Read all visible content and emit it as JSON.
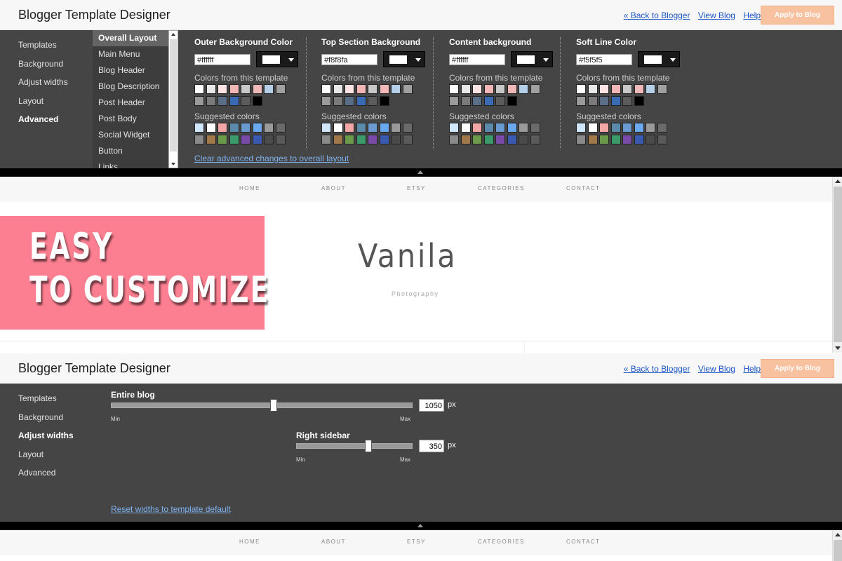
{
  "top": {
    "header": {
      "title": "Blogger Template Designer",
      "back_link": "« Back to Blogger",
      "view_blog": "View Blog",
      "help": "Help",
      "apply": "Apply to Blog"
    },
    "nav": [
      "Templates",
      "Background",
      "Adjust widths",
      "Layout",
      "Advanced"
    ],
    "nav_active": "Advanced",
    "subnav": [
      "Overall Layout",
      "Main Menu",
      "Blog Header",
      "Blog Description",
      "Post Header",
      "Post Body",
      "Social Widget",
      "Button",
      "Links"
    ],
    "subnav_active": "Overall Layout",
    "color_groups": [
      {
        "title": "Outer Background Color",
        "hex": "#ffffff"
      },
      {
        "title": "Top Section Background",
        "hex": "#f8f8fa"
      },
      {
        "title": "Content background",
        "hex": "#ffffff"
      },
      {
        "title": "Soft Line Color",
        "hex": "#f5f5f5"
      }
    ],
    "colors_from_template_label": "Colors from this template",
    "suggested_colors_label": "Suggested colors",
    "template_colors": [
      "#ffffff",
      "#e8e8e8",
      "#fce4e4",
      "#f2b6b6",
      "#c8c8c8",
      "#f0b8b8",
      "#b6cfe8",
      "#a0a0a0",
      "#9a9a9a",
      "#7a7a7a",
      "#5a6e88",
      "#3a6ab4",
      "#5c5c5c",
      "#000000"
    ],
    "suggested_colors": [
      "#cfe6fb",
      "#ffffff",
      "#f2a6a6",
      "#5c8aaa",
      "#6a9ad0",
      "#6aa8f0",
      "#9a9a9a",
      "#6a6a6a",
      "#8a8a8a",
      "#a0784a",
      "#6a9a4a",
      "#3a9a6a",
      "#7a4aa8",
      "#3a5ab0",
      "#4a4a4a",
      "#5a5a5a"
    ],
    "clear_link": "Clear advanced changes to overall layout"
  },
  "preview": {
    "menu": [
      "HOME",
      "ABOUT",
      "ETSY",
      "CATEGORIES",
      "CONTACT"
    ],
    "banner_line1": "EASY",
    "banner_line2": "TO CUSTOMIZE",
    "blog_title": "Vanila",
    "blog_subtitle": "Photography",
    "colors": {
      "banner": "#fb7f91"
    }
  },
  "bottom": {
    "header": {
      "title": "Blogger Template Designer",
      "back_link": "« Back to Blogger",
      "view_blog": "View Blog",
      "help": "Help",
      "apply": "Apply to Blog"
    },
    "nav": [
      "Templates",
      "Background",
      "Adjust widths",
      "Layout",
      "Advanced"
    ],
    "nav_active": "Adjust widths",
    "entire_blog": {
      "label": "Entire blog",
      "value": "1050",
      "unit": "px",
      "min": "Min",
      "max": "Max",
      "fraction": 0.54
    },
    "right_sidebar": {
      "label": "Right sidebar",
      "value": "350",
      "unit": "px",
      "min": "Min",
      "max": "Max",
      "fraction": 0.62
    },
    "reset_link": "Reset widths to template default"
  },
  "preview2": {
    "menu": [
      "HOME",
      "ABOUT",
      "ETSY",
      "CATEGORIES",
      "CONTACT"
    ]
  }
}
